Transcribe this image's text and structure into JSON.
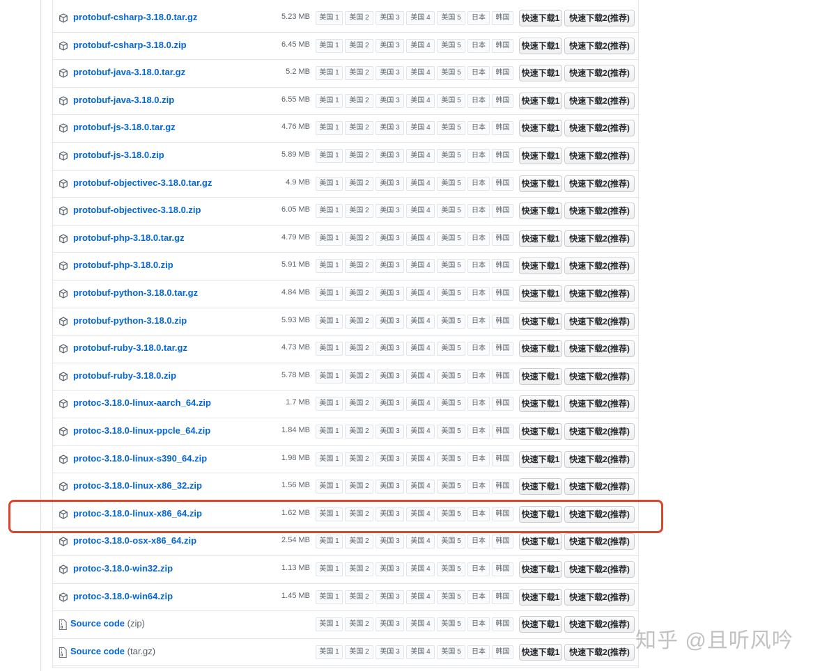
{
  "mirror_labels": [
    "美国 1",
    "美国 2",
    "美国 3",
    "美国 4",
    "美国 5",
    "日本",
    "韩国"
  ],
  "download_labels": [
    "快速下载1",
    "快速下载2(推荐)"
  ],
  "assets": [
    {
      "name": "protobuf-csharp-3.18.0.tar.gz",
      "size": "5.23 MB",
      "icon": "package-icon"
    },
    {
      "name": "protobuf-csharp-3.18.0.zip",
      "size": "6.45 MB",
      "icon": "package-icon"
    },
    {
      "name": "protobuf-java-3.18.0.tar.gz",
      "size": "5.2 MB",
      "icon": "package-icon"
    },
    {
      "name": "protobuf-java-3.18.0.zip",
      "size": "6.55 MB",
      "icon": "package-icon"
    },
    {
      "name": "protobuf-js-3.18.0.tar.gz",
      "size": "4.76 MB",
      "icon": "package-icon"
    },
    {
      "name": "protobuf-js-3.18.0.zip",
      "size": "5.89 MB",
      "icon": "package-icon"
    },
    {
      "name": "protobuf-objectivec-3.18.0.tar.gz",
      "size": "4.9 MB",
      "icon": "package-icon"
    },
    {
      "name": "protobuf-objectivec-3.18.0.zip",
      "size": "6.05 MB",
      "icon": "package-icon"
    },
    {
      "name": "protobuf-php-3.18.0.tar.gz",
      "size": "4.79 MB",
      "icon": "package-icon"
    },
    {
      "name": "protobuf-php-3.18.0.zip",
      "size": "5.91 MB",
      "icon": "package-icon"
    },
    {
      "name": "protobuf-python-3.18.0.tar.gz",
      "size": "4.84 MB",
      "icon": "package-icon"
    },
    {
      "name": "protobuf-python-3.18.0.zip",
      "size": "5.93 MB",
      "icon": "package-icon"
    },
    {
      "name": "protobuf-ruby-3.18.0.tar.gz",
      "size": "4.73 MB",
      "icon": "package-icon"
    },
    {
      "name": "protobuf-ruby-3.18.0.zip",
      "size": "5.78 MB",
      "icon": "package-icon"
    },
    {
      "name": "protoc-3.18.0-linux-aarch_64.zip",
      "size": "1.7 MB",
      "icon": "package-icon"
    },
    {
      "name": "protoc-3.18.0-linux-ppcle_64.zip",
      "size": "1.84 MB",
      "icon": "package-icon"
    },
    {
      "name": "protoc-3.18.0-linux-s390_64.zip",
      "size": "1.98 MB",
      "icon": "package-icon"
    },
    {
      "name": "protoc-3.18.0-linux-x86_32.zip",
      "size": "1.56 MB",
      "icon": "package-icon"
    },
    {
      "name": "protoc-3.18.0-linux-x86_64.zip",
      "size": "1.62 MB",
      "icon": "package-icon",
      "highlighted": true
    },
    {
      "name": "protoc-3.18.0-osx-x86_64.zip",
      "size": "2.54 MB",
      "icon": "package-icon"
    },
    {
      "name": "protoc-3.18.0-win32.zip",
      "size": "1.13 MB",
      "icon": "package-icon"
    },
    {
      "name": "protoc-3.18.0-win64.zip",
      "size": "1.45 MB",
      "icon": "package-icon"
    },
    {
      "name": "Source code",
      "suffix": "(zip)",
      "size": "",
      "icon": "file-zip-icon"
    },
    {
      "name": "Source code",
      "suffix": "(tar.gz)",
      "size": "",
      "icon": "file-zip-icon"
    }
  ],
  "watermark": "知乎 @且听风吟",
  "colors": {
    "link": "#0366d6",
    "highlight_border": "#d9472b",
    "muted_text": "#586069",
    "row_border": "#e1e4e8"
  }
}
